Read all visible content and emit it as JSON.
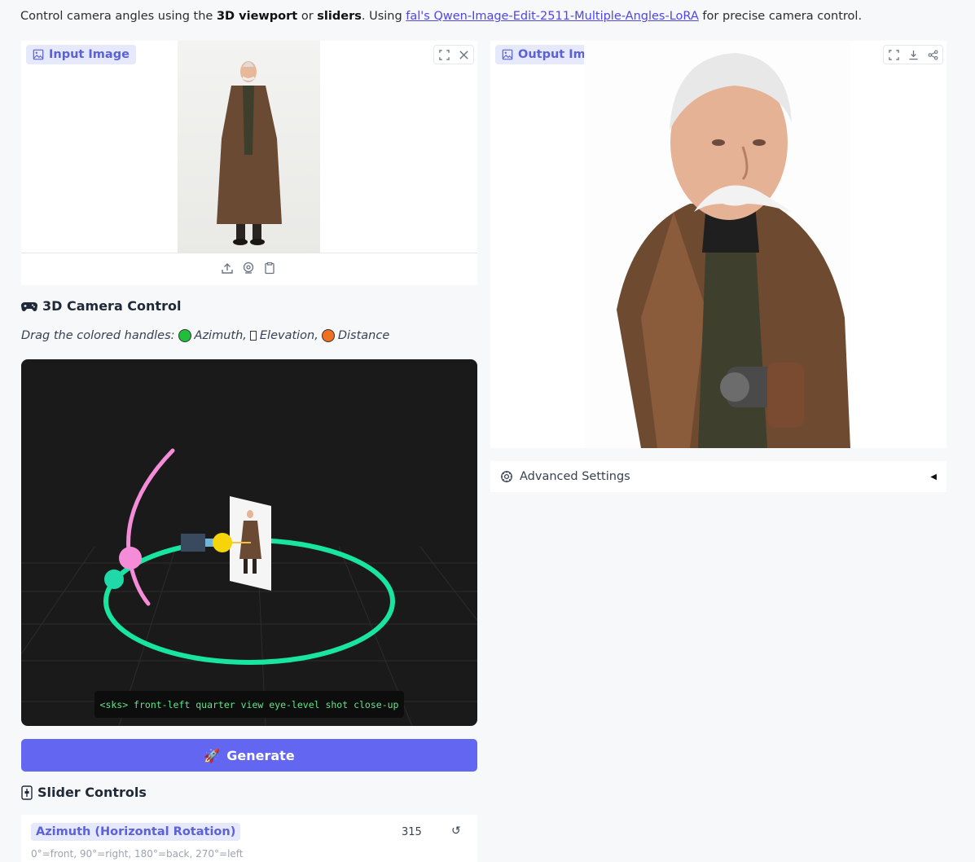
{
  "intro": {
    "prefix": "Control camera angles using the ",
    "bold1": "3D viewport",
    "mid1": " or ",
    "bold2": "sliders",
    "mid2": ". Using ",
    "link": "fal's Qwen-Image-Edit-2511-Multiple-Angles-LoRA",
    "suffix": " for precise camera control."
  },
  "input_panel": {
    "label": "Input Image",
    "icons": [
      "fullscreen-icon",
      "close-icon"
    ],
    "source_icons": [
      "upload-icon",
      "webcam-icon",
      "clipboard-icon"
    ]
  },
  "output_panel": {
    "label": "Output Image",
    "icons": [
      "fullscreen-icon",
      "download-icon",
      "share-icon"
    ]
  },
  "camera_control": {
    "title": "3D Camera Control",
    "hint_prefix": "Drag the colored handles:",
    "handles": [
      {
        "label": "Azimuth,",
        "color": "#1fbf3b"
      },
      {
        "label": "Elevation,",
        "color": "#ffffff"
      },
      {
        "label": "Distance",
        "color": "#f07020"
      }
    ],
    "prompt": "<sks> front-left quarter view eye-level shot close-up"
  },
  "colors": {
    "ring": "#18e6a0",
    "arc": "#f58cd8",
    "azimuth_handle": "#1fd9a8",
    "elevation_handle": "#f58cd8",
    "distance_handle": "#f5d50a",
    "accent": "#6366f1"
  },
  "generate": {
    "label": "Generate"
  },
  "sliders": {
    "title": "Slider Controls",
    "azimuth": {
      "label": "Azimuth (Horizontal Rotation)",
      "value": "315",
      "desc": "0°=front, 90°=right, 180°=back, 270°=left"
    }
  },
  "advanced": {
    "label": "Advanced Settings"
  }
}
